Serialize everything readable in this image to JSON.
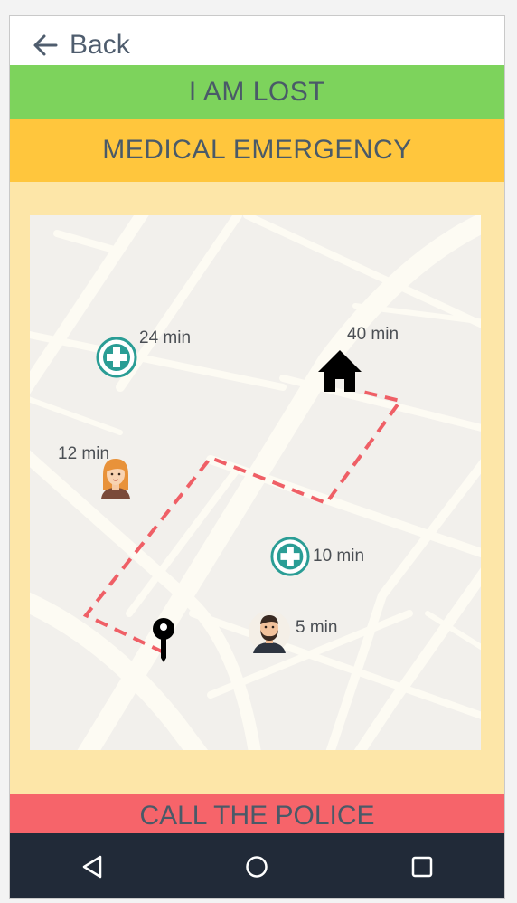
{
  "header": {
    "back_label": "Back"
  },
  "actions": {
    "lost_label": "I AM LOST",
    "medical_label": "MEDICAL EMERGENCY",
    "police_label": "CALL THE POLICE"
  },
  "colors": {
    "lost": "#7dd35c",
    "medical": "#ffc63d",
    "panel": "#fde6a8",
    "police": "#f6646a",
    "route": "#ef5f66",
    "hospital": "#2a9d95",
    "navbar": "#212a38"
  },
  "map": {
    "hospital_1_time": "24 min",
    "home_time": "40 min",
    "person_female_time": "12 min",
    "hospital_2_time": "10 min",
    "person_male_time": "5 min"
  },
  "navbar": {
    "icons": [
      "back-triangle-icon",
      "home-circle-icon",
      "recents-square-icon"
    ]
  }
}
